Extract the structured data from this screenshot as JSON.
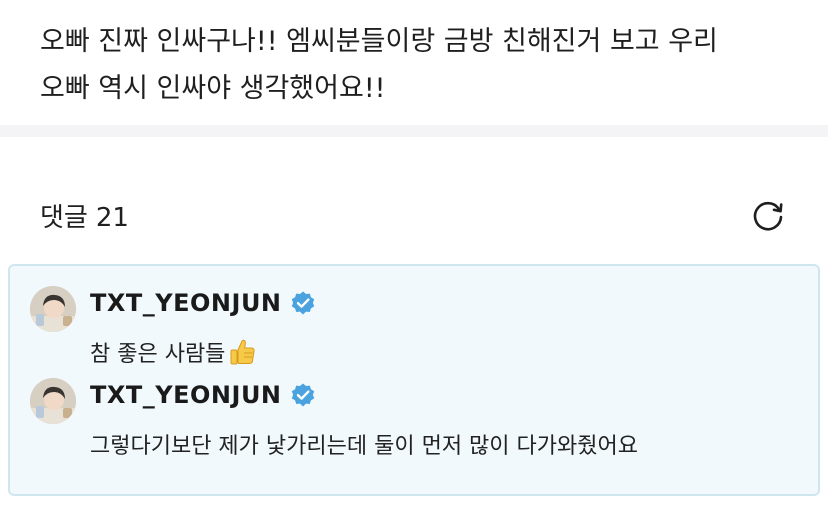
{
  "post": {
    "text_line1": "오빠 진짜 인싸구나!! 엠씨분들이랑 금방 친해진거 보고 우리",
    "text_line2": "오빠 역시 인싸야 생각했어요!!"
  },
  "comments": {
    "label": "댓글",
    "count": "21",
    "refresh_icon": "refresh-icon"
  },
  "replies": [
    {
      "author": "TXT_YEONJUN",
      "verified": true,
      "text": "참 좋은 사람들",
      "emoji": "thumbs-up"
    },
    {
      "author": "TXT_YEONJUN",
      "verified": true,
      "text": "그렇다기보단 제가 낯가리는데 둘이 먼저 많이 다가와줬어요"
    }
  ],
  "colors": {
    "highlight_bg": "#f1f9fd",
    "highlight_border": "#cfe6f1",
    "verified_blue": "#4aa3df"
  }
}
